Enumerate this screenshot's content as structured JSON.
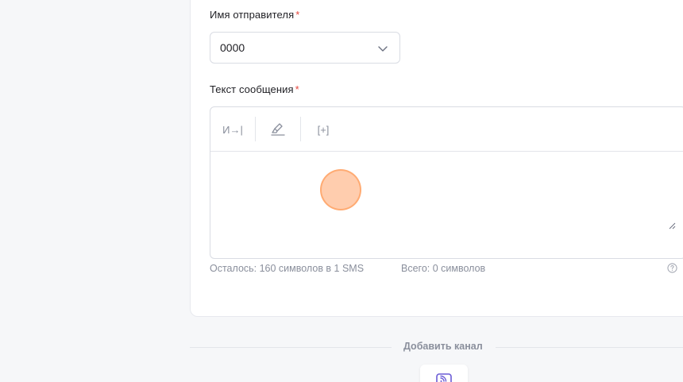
{
  "sender": {
    "label": "Имя отправителя",
    "required_mark": "*",
    "selected_value": "0000"
  },
  "message": {
    "label": "Текст сообщения",
    "required_mark": "*",
    "toolbar": [
      {
        "icon": "insert-variable-icon",
        "glyph": "И→|"
      },
      {
        "icon": "clear-format-icon"
      },
      {
        "icon": "insert-field-icon",
        "glyph": "[+]"
      }
    ],
    "text": ""
  },
  "counters": {
    "remaining": "Осталось: 160 символов в 1 SMS",
    "total": "Всего: 0 символов"
  },
  "add_channel": {
    "label": "Добавить канал"
  },
  "colors": {
    "required": "#e5483f",
    "muted": "#8a8f9c",
    "channel_icon": "#6b5cd6"
  }
}
